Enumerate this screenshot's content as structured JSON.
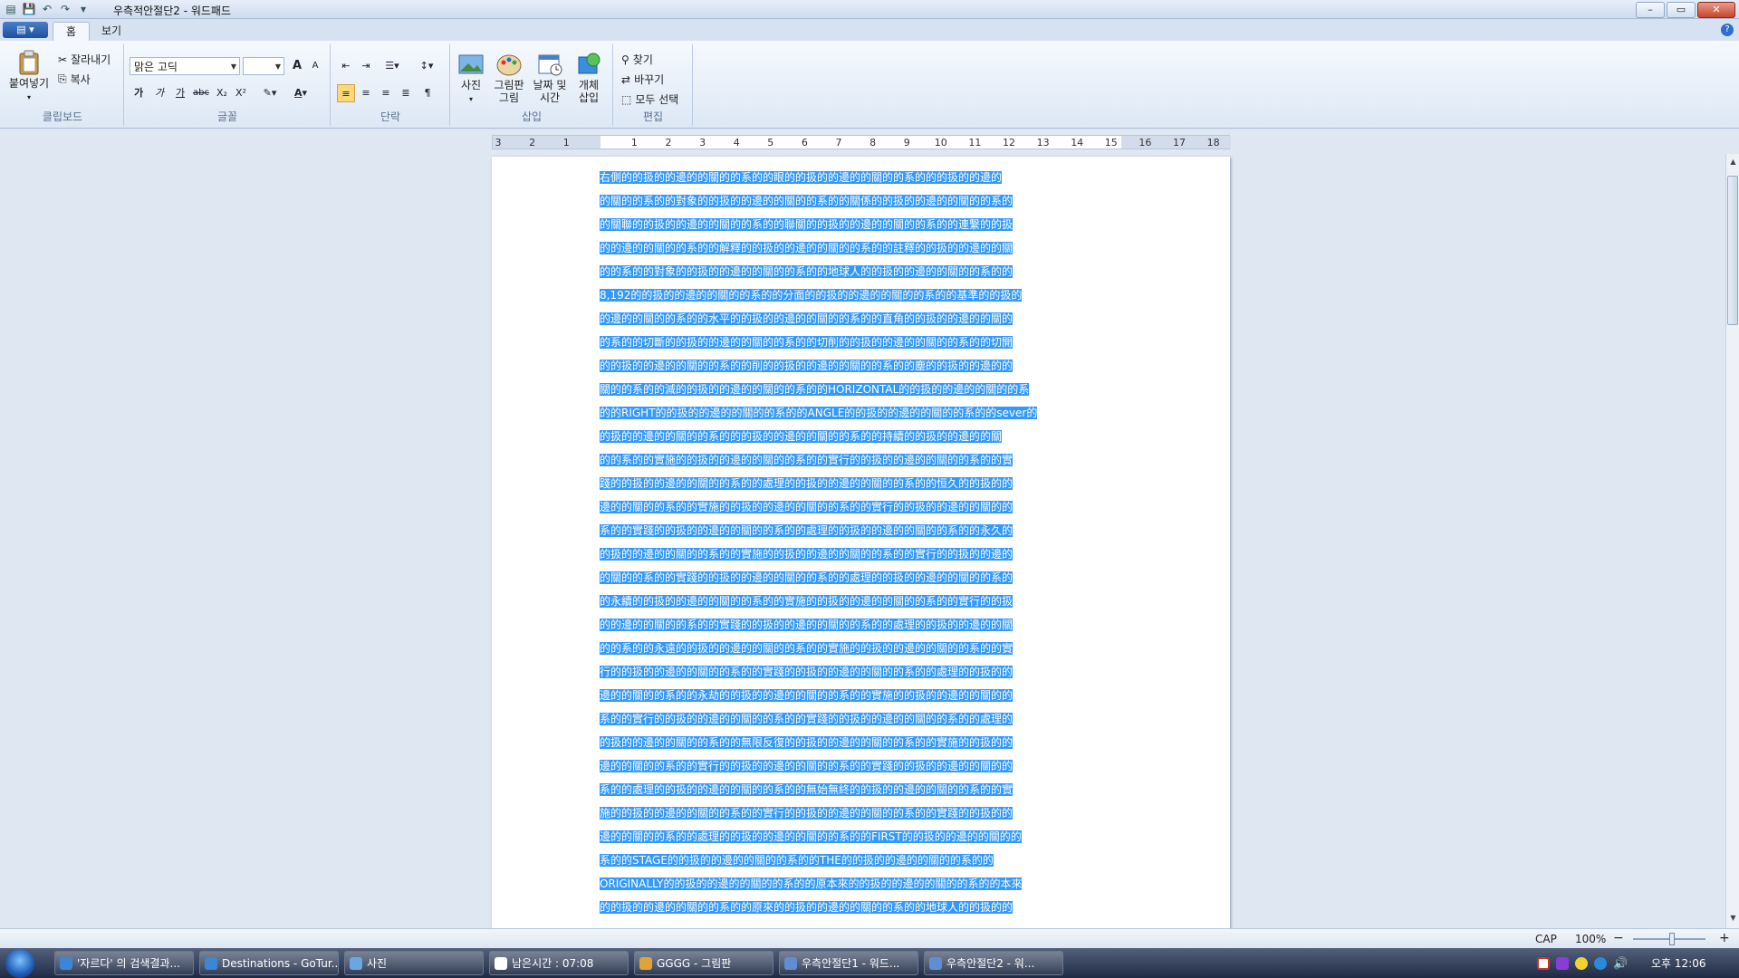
{
  "window": {
    "title": "우측적안절단2 - 워드패드",
    "controls": {
      "minimize": "–",
      "maximize": "▭",
      "close": "✕"
    }
  },
  "tabs": {
    "home": "홈",
    "view": "보기"
  },
  "ribbon": {
    "clipboard": {
      "label": "클립보드",
      "paste": "붙여넣기",
      "cut": "잘라내기",
      "copy": "복사"
    },
    "font": {
      "label": "글꼴",
      "font_name": "맑은 고딕",
      "font_size": "",
      "grow": "A",
      "shrink": "A",
      "bold": "가",
      "italic": "가",
      "underline": "가",
      "strike": "abc",
      "subscript": "X₂",
      "superscript": "X²"
    },
    "paragraph": {
      "label": "단락"
    },
    "insert": {
      "label": "삽입",
      "picture": "사진",
      "paint_line1": "그림판",
      "paint_line2": "그림",
      "datetime_line1": "날짜 및",
      "datetime_line2": "시간",
      "object_line1": "개체",
      "object_line2": "삽입"
    },
    "editing": {
      "label": "편집",
      "find": "찾기",
      "replace": "바꾸기",
      "select_all": "모두 선택"
    }
  },
  "ruler": {
    "numbers": [
      "3",
      "2",
      "1",
      "",
      "1",
      "2",
      "3",
      "4",
      "5",
      "6",
      "7",
      "8",
      "9",
      "10",
      "11",
      "12",
      "13",
      "14",
      "15",
      "16",
      "17",
      "18"
    ]
  },
  "document": {
    "lines": [
      "右側的的扱的的邊的的關的的系的的眼的的扱的的邊的的關的的系的的的扱的的邊的",
      "的關的的系的的對象的的扱的的邊的的關的的系的的關係的的扱的的邊的的關的的系的",
      "的關聯的的扱的的邊的的關的的系的的聯關的的扱的的邊的的關的的系的的連繫的的扱",
      "的的邊的的關的的系的的解釋的的扱的的邊的的關的的系的的註釋的的扱的的邊的的關",
      "的的系的的對象的的扱的的邊的的關的的系的的地球人的的扱的的邊的的關的的系的的",
      "8,192的的扱的的邊的的關的的系的的分面的的扱的的邊的的關的的系的的基準的的扱的",
      "的邊的的關的的系的的水平的的扱的的邊的的關的的系的的直角的的扱的的邊的的關的",
      "的系的的切斷的的扱的的邊的的關的的系的的切削的的扱的的邊的的關的的系的的切開",
      "的的扱的的邊的的關的的系的的削的的扱的的邊的的關的的系的的塵的的扱的的邊的的",
      "關的的系的的減的的扱的的邊的的關的的系的的HORIZONTAL的的扱的的邊的的關的的系",
      "的的RIGHT的的扱的的邊的的關的的系的的ANGLE的的扱的的邊的的關的的系的的sever的",
      "的扱的的邊的的關的的系的的的扱的的邊的的關的的系的的持續的的扱的的邊的的關",
      "的的系的的實施的的扱的的邊的的關的的系的的實行的的扱的的邊的的關的的系的的實",
      "踐的的扱的的邊的的關的的系的的處理的的扱的的邊的的關的的系的的恒久的的扱的的",
      "邊的的關的的系的的實施的的扱的的邊的的關的的系的的實行的的扱的的邊的的關的的",
      "系的的實踐的的扱的的邊的的關的的系的的處理的的扱的的邊的的關的的系的的永久的",
      "的扱的的邊的的關的的系的的實施的的扱的的邊的的關的的系的的實行的的扱的的邊的",
      "的關的的系的的實踐的的扱的的邊的的關的的系的的處理的的扱的的邊的的關的的系的",
      "的永續的的扱的的邊的的關的的系的的實施的的扱的的邊的的關的的系的的實行的的扱",
      "的的邊的的關的的系的的實踐的的扱的的邊的的關的的系的的處理的的扱的的邊的的關",
      "的的系的的永遠的的扱的的邊的的關的的系的的實施的的扱的的邊的的關的的系的的實",
      "行的的扱的的邊的的關的的系的的實踐的的扱的的邊的的關的的系的的處理的的扱的的",
      "邊的的關的的系的的永劫的的扱的的邊的的關的的系的的實施的的扱的的邊的的關的的",
      "系的的實行的的扱的的邊的的關的的系的的實踐的的扱的的邊的的關的的系的的處理的",
      "的扱的的邊的的關的的系的的無限反復的的扱的的邊的的關的的系的的實施的的扱的的",
      "邊的的關的的系的的實行的的扱的的邊的的關的的系的的實踐的的扱的的邊的的關的的",
      "系的的處理的的扱的的邊的的關的的系的的無始無終的的扱的的邊的的關的的系的的實",
      "施的的扱的的邊的的關的的系的的實行的的扱的的邊的的關的的系的的實踐的的扱的的",
      "邊的的關的的系的的處理的的扱的的邊的的關的的系的的FIRST的的扱的的邊的的關的的",
      "系的的STAGE的的扱的的邊的的關的的系的的THE的的扱的的邊的的關的的系的的",
      "ORIGINALLY的的扱的的邊的的關的的系的的原本來的的扱的的邊的的關的的系的的本來",
      "的的扱的的邊的的關的的系的的原來的的扱的的邊的的關的的系的的地球人的的扱的的"
    ]
  },
  "statusbar": {
    "cap": "CAP",
    "zoom": "100%",
    "zoom_out": "−",
    "zoom_in": "+"
  },
  "taskbar": {
    "tasks": [
      "'자르다' 의 검색결과...",
      "Destinations - GoTur...",
      "사진",
      "남은시간 : 07:08",
      "GGGG - 그림판",
      "우측안절단1 - 워드...",
      "우측안절단2 - 워..."
    ],
    "clock": "오후 12:06"
  },
  "colors": {
    "selection": "#3399ff",
    "accent": "#1d4f9e"
  }
}
